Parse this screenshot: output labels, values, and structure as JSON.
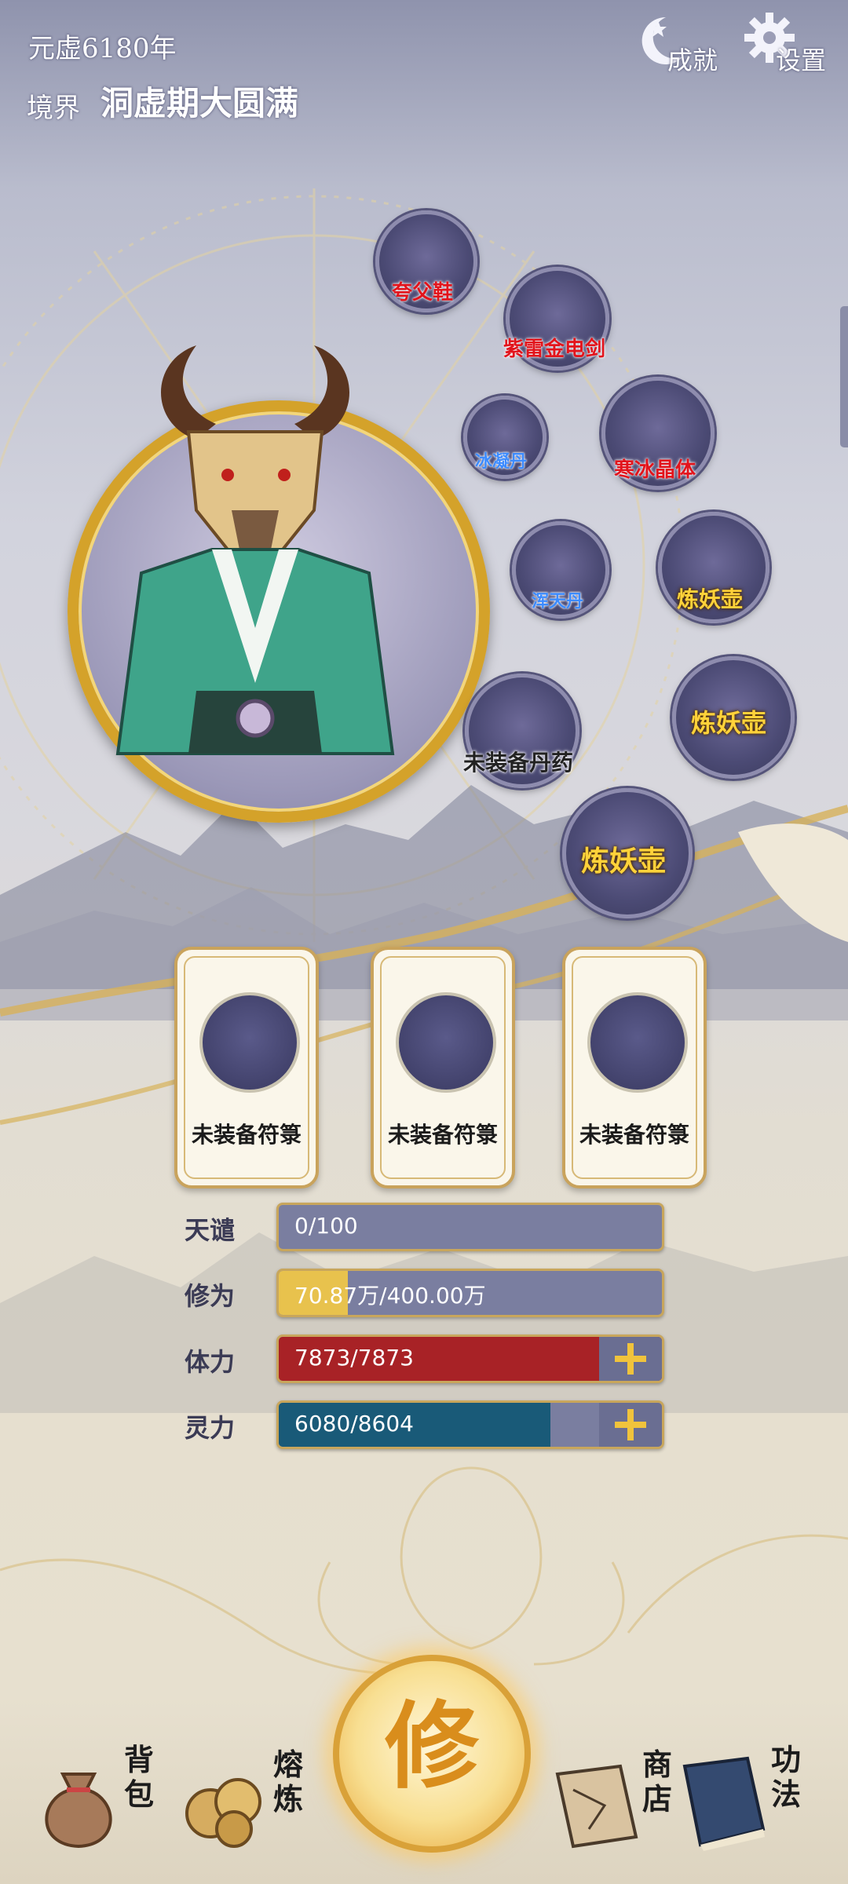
{
  "header": {
    "era": "元虚6180年",
    "realm_label": "境界",
    "realm_value": "洞虚期大圆满",
    "achievements": "成就",
    "settings": "设置"
  },
  "equipment_slots": [
    {
      "label": "夸父鞋"
    },
    {
      "label": "紫雷金电剑"
    },
    {
      "label": "冰凝丹"
    },
    {
      "label": "寒冰晶体"
    },
    {
      "label": "浑天丹"
    },
    {
      "label": "炼妖壶"
    },
    {
      "label": "未装备丹药"
    },
    {
      "label": "炼妖壶"
    },
    {
      "label": "炼妖壶"
    }
  ],
  "talismans": [
    {
      "label": "未装备符箓"
    },
    {
      "label": "未装备符箓"
    },
    {
      "label": "未装备符箓"
    }
  ],
  "stats": {
    "tianqian": {
      "label": "天谴",
      "value": "0/100",
      "fill": 0.0
    },
    "xiuwei": {
      "label": "修为",
      "value_a": "70.87万",
      "value_b": "/400.00万",
      "fill": 0.18
    },
    "tili": {
      "label": "体力",
      "value": "7873/7873",
      "fill": 1.0
    },
    "lingli": {
      "label": "灵力",
      "value": "6080/8604",
      "fill": 0.71
    }
  },
  "nav": {
    "bag": "背包",
    "refine": "熔炼",
    "cultivate": "修",
    "shop": "商店",
    "skills": "功法"
  },
  "colors": {
    "tili_bar": "#a82226",
    "lingli_bar": "#195a78",
    "xiuwei_bar": "#e8c24d",
    "accent_gold": "#c8a65c"
  }
}
